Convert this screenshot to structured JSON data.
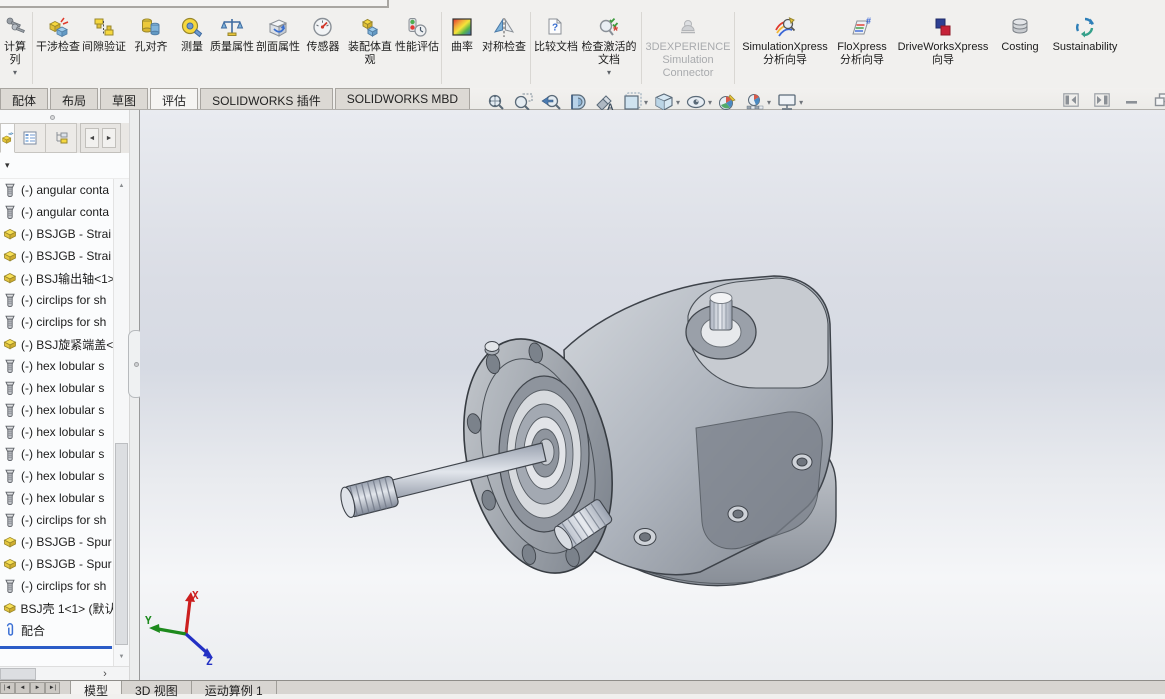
{
  "command_manager": {
    "items": [
      {
        "name": "pattern-calc",
        "label": "计算\n列"
      },
      {
        "name": "interference-detection",
        "label": "干涉检查"
      },
      {
        "name": "clearance-verification",
        "label": "间隙验证"
      },
      {
        "name": "hole-alignment",
        "label": "孔对齐"
      },
      {
        "name": "measure",
        "label": "测量"
      },
      {
        "name": "mass-properties",
        "label": "质量属性"
      },
      {
        "name": "section-properties",
        "label": "剖面属性"
      },
      {
        "name": "sensors",
        "label": "传感器"
      },
      {
        "name": "assembly-visualization",
        "label": "装配体直观"
      },
      {
        "name": "performance-evaluation",
        "label": "性能评估"
      },
      {
        "name": "curvature",
        "label": "曲率"
      },
      {
        "name": "symmetry-check",
        "label": "对称检查"
      },
      {
        "name": "compare-documents",
        "label": "比较文档"
      },
      {
        "name": "check-active-document",
        "label": "检查激活的文档"
      },
      {
        "name": "3dexperience-simulation-connector",
        "label": "3DEXPERIENCE Simulation Connector",
        "disabled": true
      },
      {
        "name": "simulationxpress-wizard",
        "label": "SimulationXpress 分析向导"
      },
      {
        "name": "floxpress-wizard",
        "label": "FloXpress 分析向导"
      },
      {
        "name": "driveworksxpress-wizard",
        "label": "DriveWorksXpress 向导"
      },
      {
        "name": "costing",
        "label": "Costing"
      },
      {
        "name": "sustainability",
        "label": "Sustainability"
      }
    ]
  },
  "command_tabs": {
    "items": [
      {
        "label": "配体",
        "active": false
      },
      {
        "label": "布局",
        "active": false
      },
      {
        "label": "草图",
        "active": false
      },
      {
        "label": "评估",
        "active": true
      },
      {
        "label": "SOLIDWORKS 插件",
        "active": false
      },
      {
        "label": "SOLIDWORKS MBD",
        "active": false
      }
    ]
  },
  "heads_up": {
    "buttons": [
      "zoom-to-fit",
      "zoom-to-area",
      "previous-view",
      "section-view",
      "hide-show-annotations",
      "view-orientation",
      "display-style",
      "hide-show-items",
      "edit-appearance",
      "apply-scene",
      "view-settings"
    ]
  },
  "window_controls": [
    "previous-window",
    "next-window",
    "minimize",
    "restore"
  ],
  "feature_tree": {
    "panel_tabs": [
      "featuremanager-design-tree",
      "propertymanager",
      "configurationmanager"
    ],
    "items": [
      {
        "icon": "bolt-icon",
        "label": "(-) angular conta"
      },
      {
        "icon": "bolt-icon",
        "label": "(-) angular conta"
      },
      {
        "icon": "part-icon",
        "label": "(-) BSJGB - Strai"
      },
      {
        "icon": "part-icon",
        "label": "(-) BSJGB - Strai"
      },
      {
        "icon": "part-icon",
        "label": "(-) BSJ输出轴<1>"
      },
      {
        "icon": "bolt-icon",
        "label": "(-) circlips for sh"
      },
      {
        "icon": "bolt-icon",
        "label": "(-) circlips for sh"
      },
      {
        "icon": "part-icon",
        "label": "(-) BSJ旋紧端盖<"
      },
      {
        "icon": "bolt-icon",
        "label": "(-) hex lobular s"
      },
      {
        "icon": "bolt-icon",
        "label": "(-) hex lobular s"
      },
      {
        "icon": "bolt-icon",
        "label": "(-) hex lobular s"
      },
      {
        "icon": "bolt-icon",
        "label": "(-) hex lobular s"
      },
      {
        "icon": "bolt-icon",
        "label": "(-) hex lobular s"
      },
      {
        "icon": "bolt-icon",
        "label": "(-) hex lobular s"
      },
      {
        "icon": "bolt-icon",
        "label": "(-) hex lobular s"
      },
      {
        "icon": "bolt-icon",
        "label": "(-) circlips for sh"
      },
      {
        "icon": "part-icon",
        "label": "(-) BSJGB - Spur"
      },
      {
        "icon": "part-icon",
        "label": "(-) BSJGB - Spur"
      },
      {
        "icon": "bolt-icon",
        "label": "(-) circlips for sh"
      },
      {
        "icon": "part-icon",
        "label": "BSJ壳 1<1> (默认"
      },
      {
        "icon": "mates-icon",
        "label": "配合"
      }
    ]
  },
  "bottom_bar": {
    "tabs": [
      {
        "label": "模型",
        "active": true
      },
      {
        "label": "3D 视图",
        "active": false
      },
      {
        "label": "运动算例 1",
        "active": false
      }
    ]
  },
  "triad": {
    "x": "X",
    "y": "Y",
    "z": "Z"
  },
  "glyphs": {
    "caret_down": "▾",
    "arrow_left_small": "◄",
    "arrow_right_small": "►",
    "scroll_up": "▲",
    "scroll_down": "▼",
    "chevron_right": "›",
    "nav_first": "|◄",
    "nav_prev": "◄",
    "nav_next": "►",
    "nav_last": "►|",
    "question_mark": "?",
    "asterisk": "*",
    "hash": "#",
    "letter_a": "A"
  },
  "colors": {
    "rollback_bar": "#2b5cc7",
    "part_icon_yellow": "#f7df55",
    "viewport_gradient_top": "#e9ebf0",
    "viewport_gradient_bottom": "#ebedf0"
  }
}
